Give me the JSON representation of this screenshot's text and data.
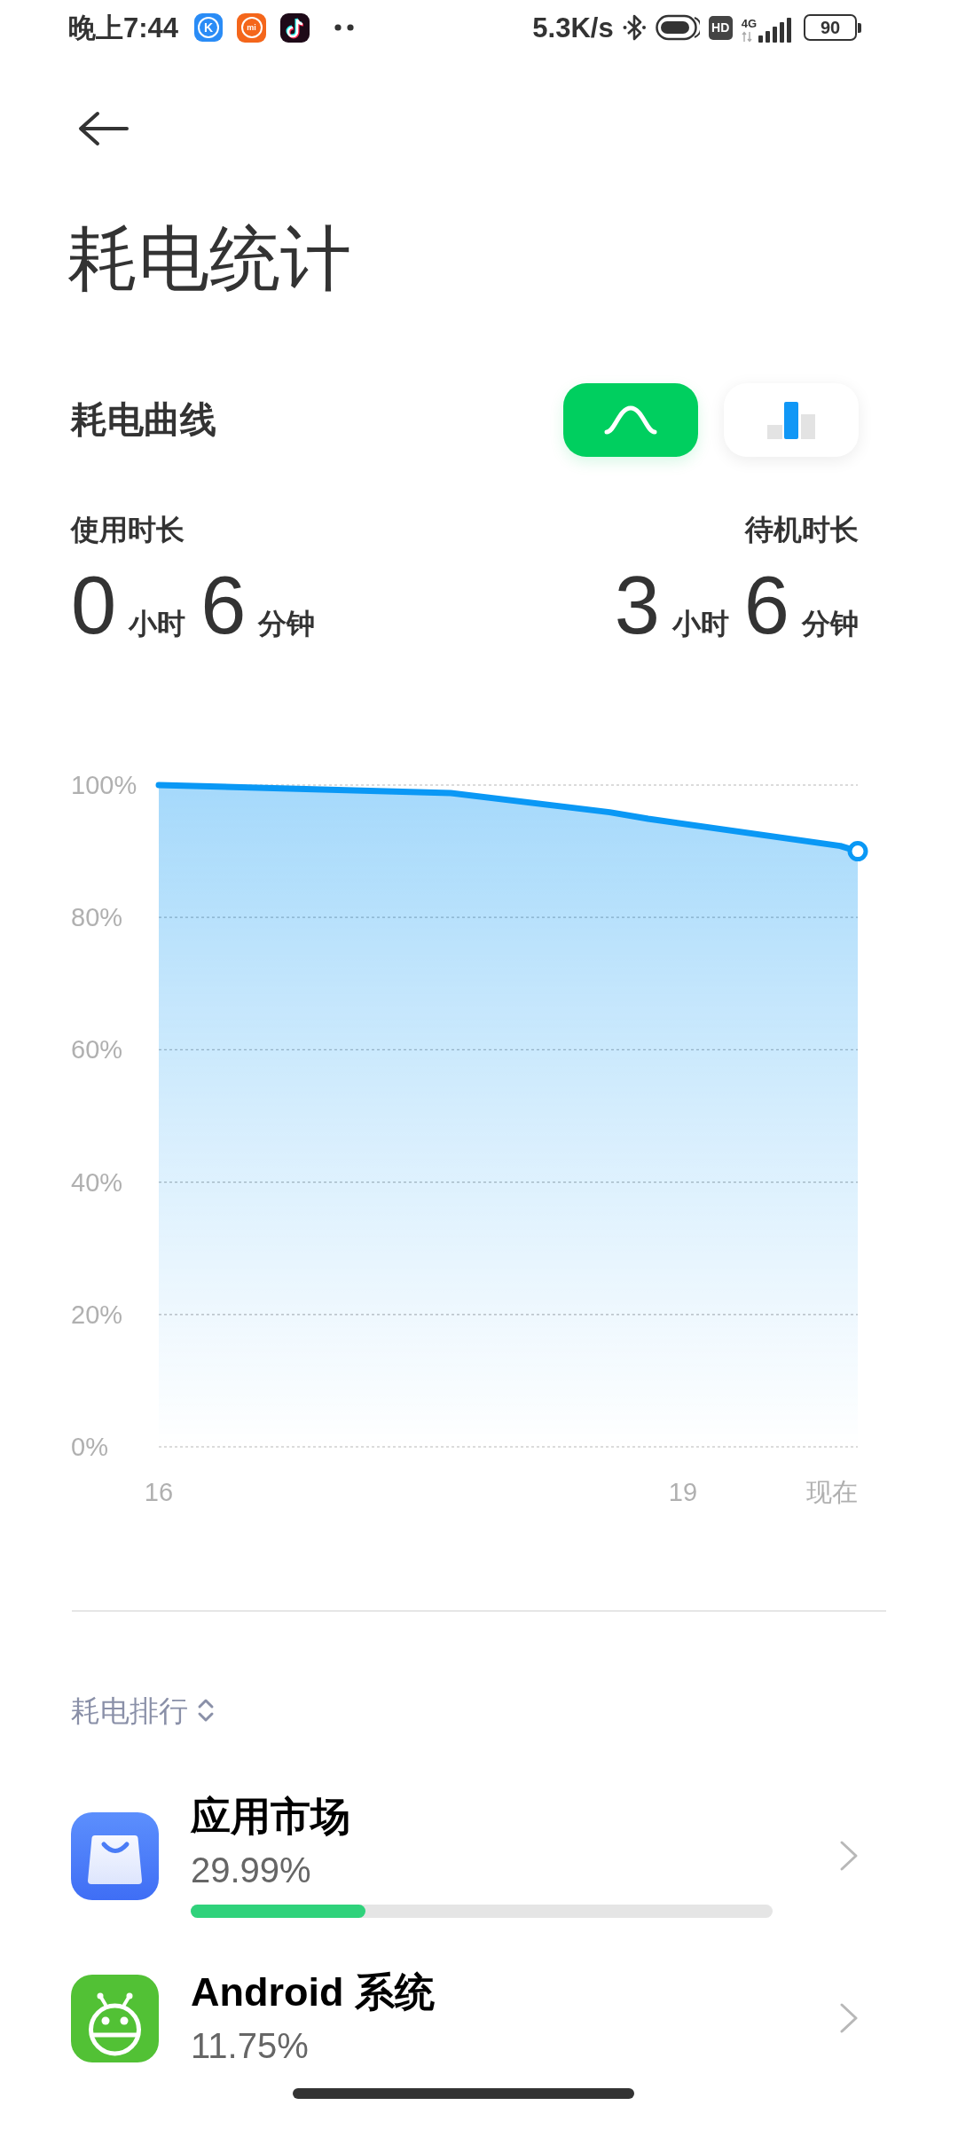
{
  "status_bar": {
    "time": "晚上7:44",
    "notification_icons": [
      {
        "kind": "k",
        "glyph": "K"
      },
      {
        "kind": "mi",
        "glyph": "mi"
      },
      {
        "kind": "tiktok"
      }
    ],
    "network_speed": "5.3K/s",
    "hd_badge": "HD",
    "network_type": "4G",
    "battery": "90"
  },
  "title": "耗电统计",
  "section_title": "耗电曲线",
  "view_toggle": [
    {
      "kind": "curve",
      "selected": true
    },
    {
      "kind": "bars",
      "selected": false
    }
  ],
  "durations": [
    {
      "label": "使用时长",
      "parts": [
        {
          "value": "0",
          "unit": "小时"
        },
        {
          "value": "6",
          "unit": "分钟"
        }
      ]
    },
    {
      "label": "待机时长",
      "parts": [
        {
          "value": "3",
          "unit": "小时"
        },
        {
          "value": "6",
          "unit": "分钟"
        }
      ]
    }
  ],
  "chart": {
    "chart_data": {
      "type": "area",
      "x": [
        16,
        17.67,
        18.58,
        18.8,
        19.9,
        20
      ],
      "series": [
        {
          "color": "#0a98f5",
          "values": [
            100,
            98.8,
            95.9,
            94.9,
            90.8,
            90
          ]
        }
      ],
      "xlim": [
        16,
        20
      ],
      "ylim": [
        0,
        100
      ],
      "xticks": [
        {
          "value": 16,
          "label": "16"
        },
        {
          "value": 19,
          "label": "19"
        },
        {
          "value": 20,
          "label": "现在"
        }
      ],
      "yticks": [
        {
          "value": 100,
          "label": "100%"
        },
        {
          "value": 80,
          "label": "80%"
        },
        {
          "value": 60,
          "label": "60%"
        },
        {
          "value": 40,
          "label": "40%"
        },
        {
          "value": 20,
          "label": "20%"
        },
        {
          "value": 0,
          "label": "0%"
        }
      ],
      "grid": true
    }
  },
  "ranking": {
    "sort_label": "耗电排行",
    "apps": [
      {
        "kind": "app-store",
        "name": "应用市场",
        "percent": "29.99%",
        "level": 0.3
      },
      {
        "kind": "android",
        "name": "Android 系统",
        "percent": "11.75%"
      }
    ]
  }
}
